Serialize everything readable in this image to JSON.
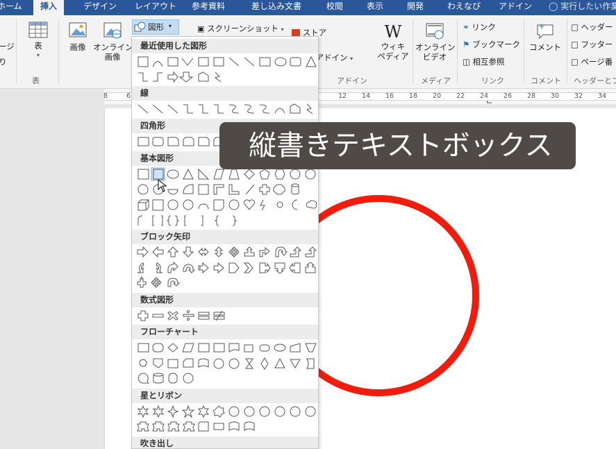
{
  "tabs": [
    {
      "label": "ホーム",
      "left": 0
    },
    {
      "label": "挿入",
      "active": true
    },
    {
      "label": "デザイン"
    },
    {
      "label": "レイアウト"
    },
    {
      "label": "参考資料"
    },
    {
      "label": "差し込み文書"
    },
    {
      "label": "校閲"
    },
    {
      "label": "表示"
    },
    {
      "label": "開発"
    },
    {
      "label": "わえなび"
    },
    {
      "label": "アドイン"
    }
  ],
  "tell_me": "実行したい作業",
  "ribbon": {
    "page_partial_1": "ージ",
    "page_partial_2": "り",
    "table_label": "表",
    "table_group": "表",
    "picture_label": "画像",
    "online_picture_label_1": "オンライン",
    "online_picture_label_2": "画像",
    "shapes_label": "図形",
    "screenshot_label": "スクリーンショット",
    "store_label": "ストア",
    "my_addins_label": "個人用アドイン",
    "wikipedia_label_1": "ウィキ",
    "wikipedia_label_2": "ペディア",
    "addins_group": "アドイン",
    "online_video_label_1": "オンライン",
    "online_video_label_2": "ビデオ",
    "media_group": "メディア",
    "link_label": "リンク",
    "bookmark_label": "ブックマーク",
    "crossref_label": "相互参照",
    "links_group": "リンク",
    "comment_label": "コメント",
    "comments_group": "コメント",
    "header_label": "ヘッダー",
    "footer_label": "フッター",
    "pagenum_label": "ページ番",
    "hf_group": "ヘッダーとフ"
  },
  "ruler": {
    "left_numbers": [
      "8",
      "6"
    ],
    "numbers": [
      "12",
      "14",
      "16",
      "18",
      "20",
      "22",
      "24",
      "26",
      "28",
      "30",
      "32",
      "34"
    ]
  },
  "gallery": {
    "categories": [
      "最近使用した図形",
      "線",
      "四角形",
      "基本図形",
      "ブロック矢印",
      "数式図形",
      "フローチャート",
      "星とリボン",
      "吹き出し"
    ]
  },
  "tooltip_text": "縦書きテキストボックス",
  "colors": {
    "tab_bar": "#2b579a",
    "circle_red": "#f01d0c",
    "tooltip_bg": "#4f4a45"
  }
}
